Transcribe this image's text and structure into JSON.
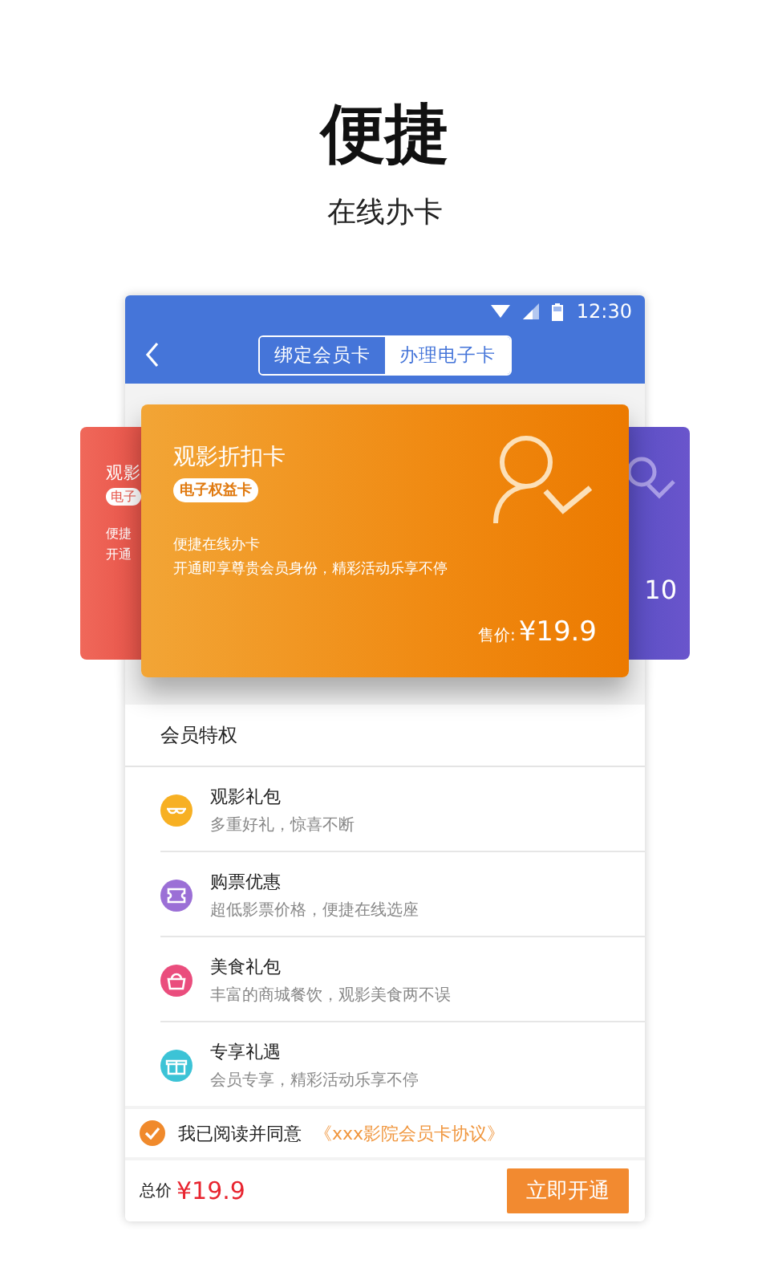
{
  "header": {
    "title": "便捷",
    "subtitle": "在线办卡"
  },
  "status_bar": {
    "time": "12:30"
  },
  "tabs": [
    {
      "label": "绑定会员卡",
      "selected": false
    },
    {
      "label": "办理电子卡",
      "selected": true
    }
  ],
  "cards": [
    {
      "kind": "left",
      "title": "观影",
      "badge": "电子",
      "lines": [
        "便捷",
        "开通"
      ],
      "color": "#f0685a"
    },
    {
      "kind": "main",
      "title": "观影折扣卡",
      "badge": "电子权益卡",
      "lines": [
        "便捷在线办卡",
        "开通即享尊贵会员身份，精彩活动乐享不停"
      ],
      "price_label": "售价:",
      "price": "¥19.9",
      "color": "#f08a12"
    },
    {
      "kind": "right",
      "price": "10",
      "color": "#6a55cc"
    }
  ],
  "perks": {
    "title": "会员特权",
    "items": [
      {
        "name": "观影礼包",
        "desc": "多重好礼，惊喜不断",
        "color": "#f7b023"
      },
      {
        "name": "购票优惠",
        "desc": "超低影票价格，便捷在线选座",
        "color": "#9b6fd6"
      },
      {
        "name": "美食礼包",
        "desc": "丰富的商城餐饮，观影美食两不误",
        "color": "#ea4d7d"
      },
      {
        "name": "专享礼遇",
        "desc": "会员专享，精彩活动乐享不停",
        "color": "#3cc3d6"
      }
    ]
  },
  "agreement": {
    "checked": true,
    "text": "我已阅读并同意",
    "link": "《xxx影院会员卡协议》"
  },
  "footer": {
    "total_label": "总价",
    "total": "¥19.9",
    "button": "立即开通"
  }
}
